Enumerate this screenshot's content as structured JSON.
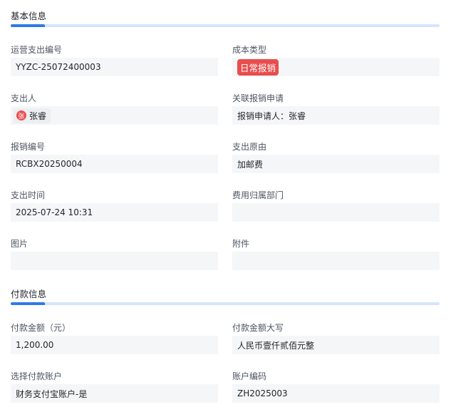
{
  "sections": {
    "basic": {
      "title": "基本信息",
      "fields": {
        "expense_no": {
          "label": "运营支出编号",
          "value": "YYZC-25072400003"
        },
        "cost_type": {
          "label": "成本类型",
          "value": "日常报销"
        },
        "payer": {
          "label": "支出人",
          "avatar": "张",
          "value": "张睿"
        },
        "related_request": {
          "label": "关联报销申请",
          "value": "报销申请人：张睿"
        },
        "reimburse_no": {
          "label": "报销编号",
          "value": "RCBX20250004"
        },
        "reason": {
          "label": "支出原由",
          "value": "加邮费"
        },
        "time": {
          "label": "支出时间",
          "value": "2025-07-24 10:31"
        },
        "department": {
          "label": "费用归属部门",
          "value": ""
        },
        "images": {
          "label": "图片",
          "value": ""
        },
        "attachments": {
          "label": "附件",
          "value": ""
        }
      }
    },
    "payment": {
      "title": "付款信息",
      "fields": {
        "amount": {
          "label": "付款金额（元）",
          "value": "1,200.00"
        },
        "amount_upper": {
          "label": "付款金额大写",
          "value": "人民币壹仟贰佰元整"
        },
        "account": {
          "label": "选择付款账户",
          "value": "财务支付宝账户-是"
        },
        "account_code": {
          "label": "账户编码",
          "value": "ZH2025003"
        }
      }
    }
  },
  "colors": {
    "accent": "#2f7ae5",
    "tag_red": "#e84e4e",
    "field_bg": "#f5f6f8"
  }
}
